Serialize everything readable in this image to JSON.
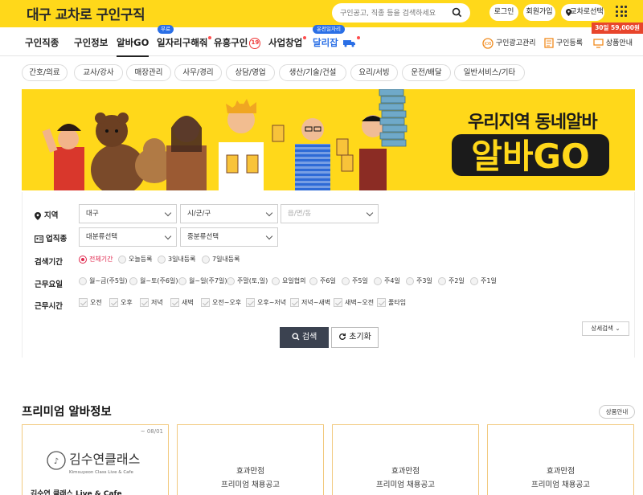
{
  "header": {
    "logo_part1": "대구 ",
    "logo_part2": "교차로",
    "logo_part3": " 구인구직",
    "search_placeholder": "구인공고, 직종 등을 검색하세요",
    "login": "로그인",
    "signup": "회원가입",
    "region": "교차로선택"
  },
  "nav": {
    "items": [
      {
        "label": "구인직종"
      },
      {
        "label": "구인정보"
      },
      {
        "label": "알바GO"
      },
      {
        "label": "일자리구해줘"
      },
      {
        "label": "유흥구인"
      },
      {
        "label": "사업창업"
      },
      {
        "label": "달리잡"
      }
    ],
    "free_tag": "무료",
    "driver_tag": "운전일자리",
    "adult_badge": "19",
    "right": {
      "ad_manage": "구인광고관리",
      "register": "구인등록",
      "product_info": "상품안내",
      "price": "30일 59,000원"
    }
  },
  "chips": [
    "간호/의료",
    "교사/강사",
    "매장관리",
    "사무/경리",
    "상담/영업",
    "생산/기술/건설",
    "요리/서빙",
    "운전/배달",
    "일반서비스/기타"
  ],
  "banner": {
    "title": "우리지역 동네알바",
    "logo_text": "알바GO"
  },
  "filter": {
    "region_label": "지역",
    "region_selects": [
      "대구",
      "시/군/구",
      "읍/면/동"
    ],
    "jobtype_label": "업직종",
    "jobtype_selects": [
      "대분류선택",
      "중분류선택"
    ],
    "period_label": "검색기간",
    "period_options": [
      "전체기간",
      "오늘등록",
      "3일내등록",
      "7일내등록"
    ],
    "weekday_label": "근무요일",
    "weekday_options": [
      "월~금(주5일)",
      "월~토(주6일)",
      "월~일(주7일)",
      "주말(토,일)",
      "요일협의",
      "주6일",
      "주5일",
      "주4일",
      "주3일",
      "주2일",
      "주1일"
    ],
    "time_label": "근무시간",
    "time_options": [
      "오전",
      "오후",
      "저녁",
      "새벽",
      "오전~오후",
      "오후~저녁",
      "저녁~새벽",
      "새벽~오전",
      "풀타임"
    ],
    "search_btn": "검색",
    "reset_btn": "초기화",
    "detail_btn": "상세검색"
  },
  "premium": {
    "title": "프리미엄 알바정보",
    "product_btn": "상품안내",
    "cards": [
      {
        "date": "~ 08/01",
        "logo_main": "김수연클래스",
        "logo_sub": "Kimsuyeon Class  Live & Cafe",
        "company": "김수연 클래스 Live & Cafe"
      },
      {
        "line1": "효과만점",
        "line2": "프리미엄 채용공고"
      },
      {
        "line1": "효과만점",
        "line2": "프리미엄 채용공고"
      },
      {
        "line1": "효과만점",
        "line2": "프리미엄 채용공고"
      }
    ]
  },
  "colors": {
    "brand_yellow": "#ffd81a",
    "accent_blue": "#2a6fe6",
    "accent_red": "#e8452c",
    "radio_on": "#e0284e"
  }
}
